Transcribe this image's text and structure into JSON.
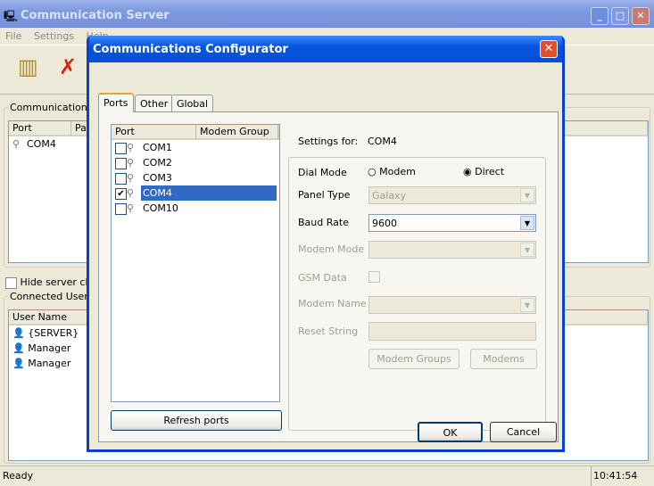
{
  "main": {
    "title": "Communication Server",
    "menu": [
      "File",
      "Settings",
      "Help"
    ],
    "comms_group": "Communications Ports",
    "comms_columns": [
      "Port",
      "Path"
    ],
    "comms_rows": [
      "COM4"
    ],
    "hide_server_label": "Hide server clients",
    "users_group": "Connected Users",
    "users_column": "User Name",
    "users": [
      "{SERVER}",
      "Manager",
      "Manager"
    ],
    "status": "Ready",
    "time": "10:41:54"
  },
  "dialog": {
    "title": "Communications Configurator",
    "tabs": [
      "Ports",
      "Other",
      "Global"
    ],
    "active_tab": "Ports",
    "port_columns": [
      "Port",
      "Modem Group"
    ],
    "ports": [
      {
        "name": "COM1",
        "checked": false
      },
      {
        "name": "COM2",
        "checked": false
      },
      {
        "name": "COM3",
        "checked": false
      },
      {
        "name": "COM4",
        "checked": true,
        "selected": true
      },
      {
        "name": "COM10",
        "checked": false
      }
    ],
    "refresh_label": "Refresh ports",
    "settings_for_label": "Settings for:",
    "settings_for_value": "COM4",
    "dial_mode_label": "Dial Mode",
    "dial_mode_options": [
      "Modem",
      "Direct"
    ],
    "dial_mode_selected": "Direct",
    "panel_type_label": "Panel Type",
    "panel_type_value": "Galaxy",
    "baud_rate_label": "Baud Rate",
    "baud_rate_value": "9600",
    "modem_mode_label": "Modem Mode",
    "gsm_data_label": "GSM Data",
    "modem_name_label": "Modem Name",
    "reset_string_label": "Reset String",
    "modem_groups_label": "Modem Groups",
    "modems_label": "Modems",
    "ok_label": "OK",
    "cancel_label": "Cancel"
  },
  "colors": {
    "selection": "#316ac5",
    "dialog_title": "#0854e0"
  }
}
